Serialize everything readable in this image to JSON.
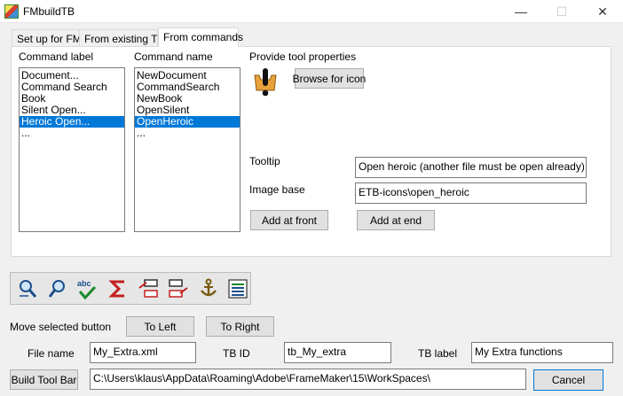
{
  "window": {
    "title": "FMbuildTB",
    "minimize_glyph": "—",
    "maximize_glyph": "☐",
    "close_glyph": "✕"
  },
  "tabs": [
    {
      "label": "Set up for FM"
    },
    {
      "label": "From existing TB"
    },
    {
      "label": "From commands"
    }
  ],
  "command_label": {
    "heading": "Command label",
    "items": [
      "Document...",
      "Command Search",
      "Book",
      "Silent Open...",
      "Heroic Open...",
      "..."
    ],
    "selected_index": 4
  },
  "command_name": {
    "heading": "Command name",
    "items": [
      "NewDocument",
      "CommandSearch",
      "NewBook",
      "OpenSilent",
      "OpenHeroic",
      "..."
    ],
    "selected_index": 4
  },
  "tool_properties": {
    "heading": "Provide tool properties",
    "browse_button": "Browse for icon",
    "preview_icon": "heroic-open-icon",
    "tooltip_label": "Tooltip",
    "tooltip_value": "Open heroic (another file must be open already)",
    "image_base_label": "Image base",
    "image_base_value": "ETB-icons\\open_heroic",
    "add_front_button": "Add at front",
    "add_end_button": "Add at end"
  },
  "toolbar_icons": [
    "zoom-page-icon",
    "zoom-in-icon",
    "spell-check-icon",
    "sigma-icon",
    "move-left-icon",
    "move-right-icon",
    "anchor-icon",
    "list-icon"
  ],
  "move": {
    "label": "Move selected button",
    "left_button": "To Left",
    "right_button": "To Right"
  },
  "fields": {
    "file_name_label": "File name",
    "file_name_value": "My_Extra.xml",
    "tb_id_label": "TB ID",
    "tb_id_value": "tb_My_extra",
    "tb_label_label": "TB label",
    "tb_label_value": "My Extra functions"
  },
  "footer": {
    "build_button": "Build Tool Bar",
    "path_value": "C:\\Users\\klaus\\AppData\\Roaming\\Adobe\\FrameMaker\\15\\WorkSpaces\\",
    "cancel_button": "Cancel"
  },
  "colors": {
    "selection": "#0078d7",
    "window_bg": "#f0f0f0",
    "panel_bg": "#ffffff"
  }
}
